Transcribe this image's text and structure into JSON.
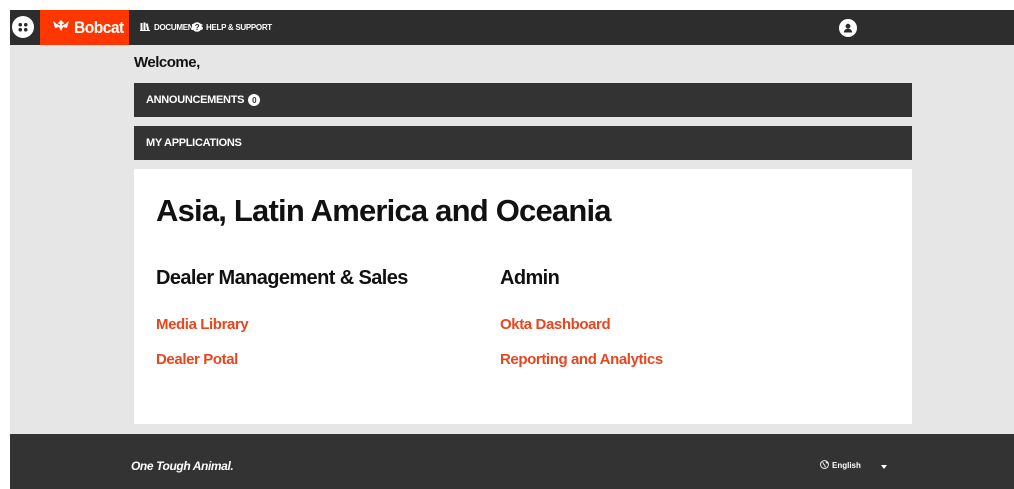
{
  "header": {
    "brand_name": "Bobcat",
    "nav": {
      "documents_label": "DOCUMENTS",
      "help_label": "HELP & SUPPORT"
    },
    "icons": {
      "apps": "apps-grid-icon",
      "brand": "bobcat-logo-icon",
      "documents": "documents-icon",
      "help": "help-circle-icon",
      "user": "user-avatar-icon"
    }
  },
  "welcome": {
    "text": "Welcome,"
  },
  "announcements": {
    "label": "ANNOUNCEMENTS",
    "count": "0"
  },
  "my_applications": {
    "label": "MY APPLICATIONS",
    "region": "Asia, Latin America and Oceania",
    "groups": [
      {
        "title": "Dealer Management & Sales",
        "links": [
          "Media Library",
          "Dealer Potal"
        ]
      },
      {
        "title": "Admin",
        "links": [
          "Okta Dashboard",
          "Reporting and Analytics"
        ]
      }
    ]
  },
  "footer": {
    "tagline": "One Tough Animal.",
    "language": "English",
    "icons": {
      "language": "globe-icon",
      "dropdown": "chevron-down-icon"
    }
  },
  "colors": {
    "brand_orange": "#ff3600",
    "link_orange": "#e8461e",
    "dark_bar": "#333333",
    "page_bg": "#e6e6e6"
  }
}
